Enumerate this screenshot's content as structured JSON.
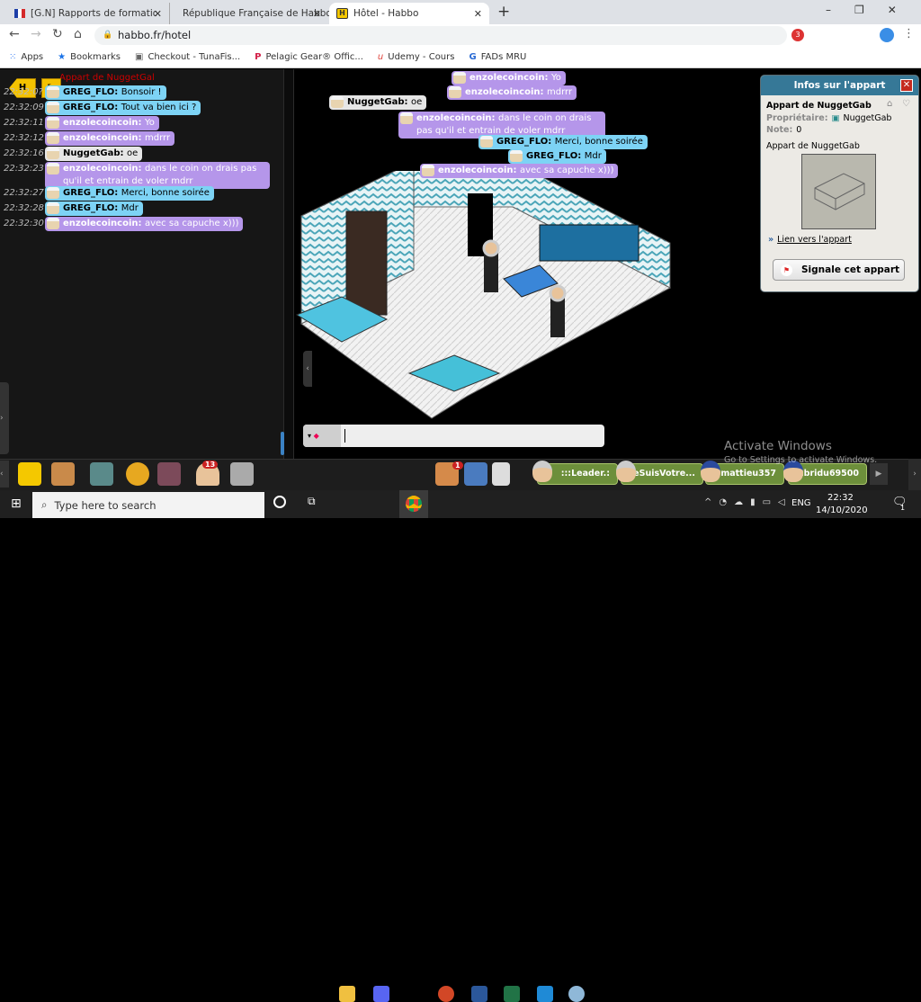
{
  "browser": {
    "tabs": [
      {
        "label": "[G.N] Rapports de formations de",
        "icon": "french-flag-icon"
      },
      {
        "label": "République Française de Habbo",
        "icon": "french-flag-icon"
      },
      {
        "label": "Hôtel - Habbo",
        "icon": "habbo-h-icon",
        "active": true
      }
    ],
    "url": "habbo.fr/hotel",
    "bookmarks": [
      "Apps",
      "Bookmarks",
      "Checkout - TunaFis...",
      "Pelagic Gear® Offic...",
      "Udemy - Cours",
      "FADs MRU"
    ],
    "extension_badge": "3"
  },
  "chatlog": {
    "header": "Appart de NuggetGal",
    "entries": [
      {
        "time": "22:32:0?",
        "user": "GREG_FLO",
        "text": "Bonsoir !",
        "style": "greg"
      },
      {
        "time": "22:32:09",
        "user": "GREG_FLO",
        "text": "Tout va bien ici ?",
        "style": "greg"
      },
      {
        "time": "22:32:11",
        "user": "enzolecoincoin",
        "text": "Yo",
        "style": "enzo"
      },
      {
        "time": "22:32:12",
        "user": "enzolecoincoin",
        "text": "mdrrr",
        "style": "enzo"
      },
      {
        "time": "22:32:16",
        "user": "NuggetGab",
        "text": "oe",
        "style": "nug"
      },
      {
        "time": "22:32:23",
        "user": "enzolecoincoin",
        "text": "dans le coin on drais pas qu'il et entrain de voler mdrr",
        "style": "enzo"
      },
      {
        "time": "22:32:27",
        "user": "GREG_FLO",
        "text": "Merci, bonne soirée",
        "style": "greg"
      },
      {
        "time": "22:32:28",
        "user": "GREG_FLO",
        "text": "Mdr",
        "style": "greg"
      },
      {
        "time": "22:32:30",
        "user": "enzolecoincoin",
        "text": "avec sa capuche x)))",
        "style": "enzo"
      }
    ]
  },
  "room_bubbles": [
    {
      "user": "enzolecoincoin",
      "text": "Yo",
      "style": "enzo"
    },
    {
      "user": "enzolecoincoin",
      "text": "mdrrr",
      "style": "enzo"
    },
    {
      "user": "NuggetGab",
      "text": "oe",
      "style": "nug"
    },
    {
      "user": "enzolecoincoin",
      "text": "dans le coin on drais pas qu'il et entrain de voler mdrr",
      "style": "enzo"
    },
    {
      "user": "GREG_FLO",
      "text": "Merci, bonne soirée",
      "style": "greg"
    },
    {
      "user": "GREG_FLO",
      "text": "Mdr",
      "style": "greg"
    },
    {
      "user": "enzolecoincoin",
      "text": "avec sa capuche x)))",
      "style": "enzo"
    }
  ],
  "info_panel": {
    "title": "Infos sur l'appart",
    "room_name": "Appart de NuggetGab",
    "owner_label": "Propriétaire:",
    "owner": "NuggetGab",
    "rating_label": "Note:",
    "rating": "0",
    "description": "Appart de NuggetGab",
    "link": "Lien vers l'appart",
    "report_button": "Signale cet appart"
  },
  "toolbar": {
    "icons": [
      "hotel-icon",
      "rooms-icon",
      "shop-icon",
      "builder-icon",
      "inventory-icon",
      "avatar-icon",
      "camera-icon"
    ],
    "avatar_badge": "13",
    "friends_badge": "1",
    "friends": [
      ":::Leader.:",
      "JeSuisVotre...",
      "mattieu357",
      "sabridu69500"
    ]
  },
  "watermark": {
    "title": "Activate Windows",
    "subtitle": "Go to Settings to activate Windows."
  },
  "taskbar": {
    "search_placeholder": "Type here to search",
    "language": "ENG",
    "time": "22:32",
    "date": "14/10/2020",
    "notification_count": "1"
  },
  "colors": {
    "greg_bubble": "#7dd3f5",
    "enzo_bubble": "#b596ea",
    "nugget_bubble": "#e6e6e6",
    "panel_header": "#367897",
    "friend_bar": "#6d8f3b"
  }
}
